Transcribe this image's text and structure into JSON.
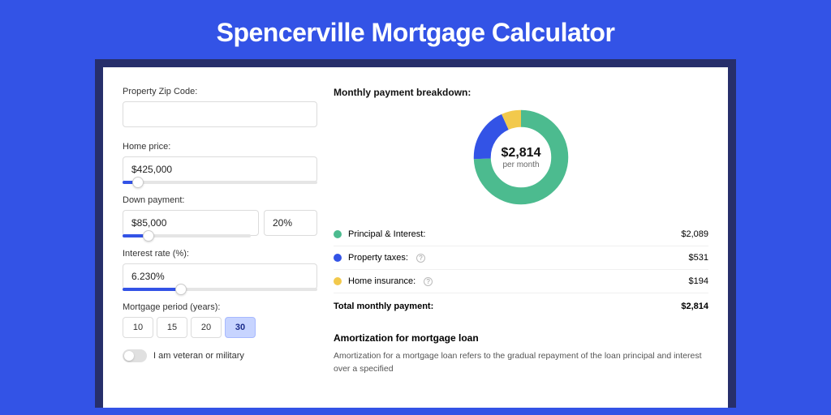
{
  "title": "Spencerville Mortgage Calculator",
  "left": {
    "zip_label": "Property Zip Code:",
    "zip_value": "",
    "home_price_label": "Home price:",
    "home_price_value": "$425,000",
    "home_price_slider_pct": 8,
    "down_label": "Down payment:",
    "down_value": "$85,000",
    "down_pct_value": "20%",
    "down_slider_pct": 20,
    "rate_label": "Interest rate (%):",
    "rate_value": "6.230%",
    "rate_slider_pct": 30,
    "period_label": "Mortgage period (years):",
    "periods": [
      "10",
      "15",
      "20",
      "30"
    ],
    "period_selected": "30",
    "veteran_label": "I am veteran or military"
  },
  "right": {
    "breakdown_title": "Monthly payment breakdown:",
    "monthly_value": "$2,814",
    "monthly_sub": "per month",
    "rows": [
      {
        "label": "Principal & Interest:",
        "value": "$2,089",
        "color": "g",
        "info": false
      },
      {
        "label": "Property taxes:",
        "value": "$531",
        "color": "b",
        "info": true
      },
      {
        "label": "Home insurance:",
        "value": "$194",
        "color": "y",
        "info": true
      }
    ],
    "total_label": "Total monthly payment:",
    "total_value": "$2,814",
    "amort_title": "Amortization for mortgage loan",
    "amort_body": "Amortization for a mortgage loan refers to the gradual repayment of the loan principal and interest over a specified"
  },
  "chart_data": {
    "type": "pie",
    "title": "Monthly payment breakdown",
    "series": [
      {
        "name": "Principal & Interest",
        "value": 2089,
        "color": "#4cbb8f"
      },
      {
        "name": "Property taxes",
        "value": 531,
        "color": "#3353e6"
      },
      {
        "name": "Home insurance",
        "value": 194,
        "color": "#f2c94c"
      }
    ],
    "total": 2814,
    "center_label": "$2,814 per month"
  }
}
